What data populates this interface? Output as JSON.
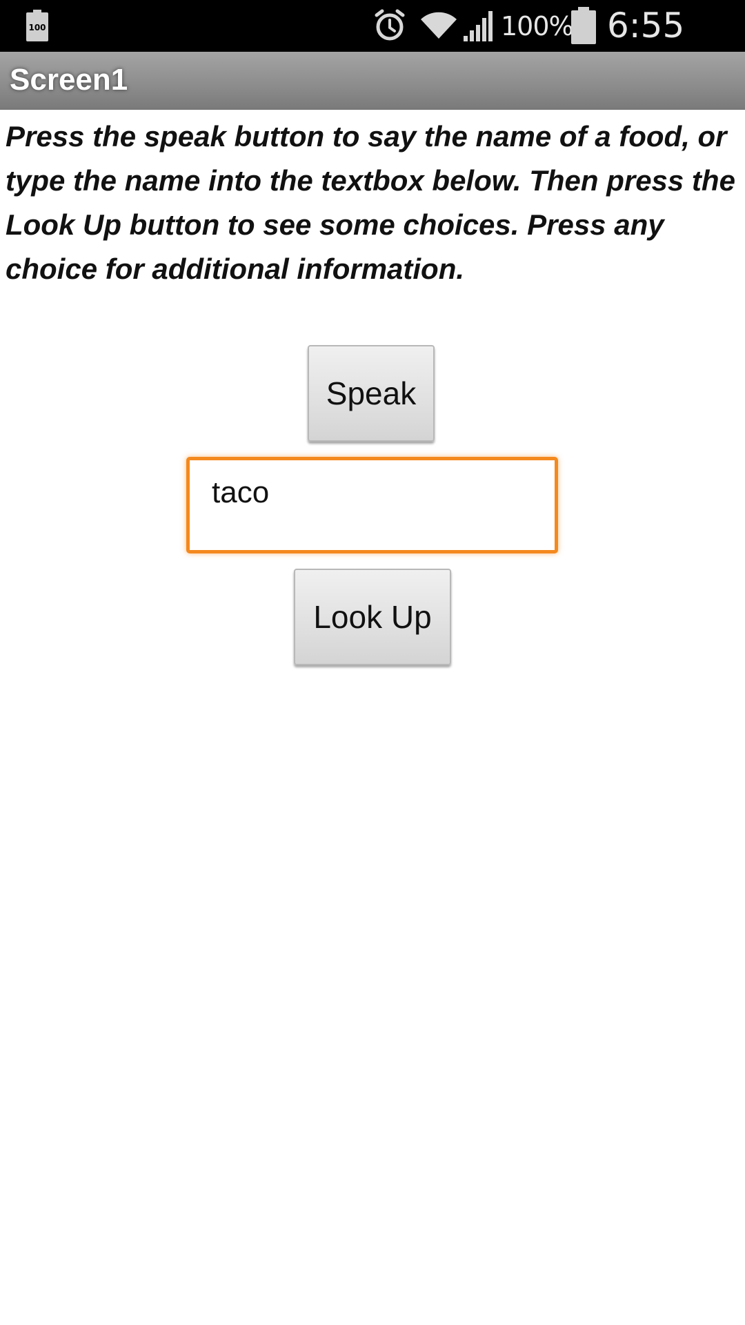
{
  "status_bar": {
    "battery_saver_label": "100",
    "battery_percent": "100%",
    "time": "6:55 AM",
    "icons": [
      "battery-saver-icon",
      "alarm-icon",
      "wifi-icon",
      "signal-icon",
      "battery-icon"
    ]
  },
  "title_bar": {
    "title": "Screen1"
  },
  "instructions": {
    "text": "Press the speak button to say the name of a food, or type the name into the textbox below. Then press the Look Up button to see some choices. Press any choice for additional information."
  },
  "controls": {
    "speak_label": "Speak",
    "food_value": "taco",
    "lookup_label": "Look Up",
    "focus_color": "#f4891e"
  }
}
